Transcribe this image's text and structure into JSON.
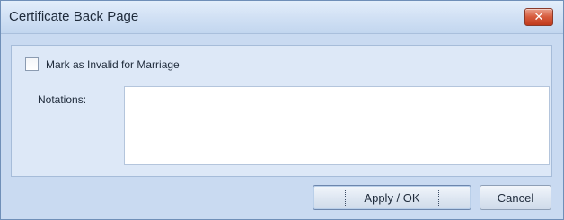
{
  "window": {
    "title": "Certificate Back Page",
    "close_symbol": "✕",
    "close_icon": "close-icon"
  },
  "form": {
    "invalid_checkbox": {
      "label": "Mark as Invalid for Marriage",
      "checked": false
    },
    "notations": {
      "label": "Notations:",
      "value": "",
      "placeholder": ""
    }
  },
  "buttons": {
    "apply_label": "Apply / OK",
    "cancel_label": "Cancel"
  },
  "colors": {
    "window_background": "#c9daf1",
    "panel_background": "#dde8f7",
    "close_button": "#d65a3c"
  }
}
